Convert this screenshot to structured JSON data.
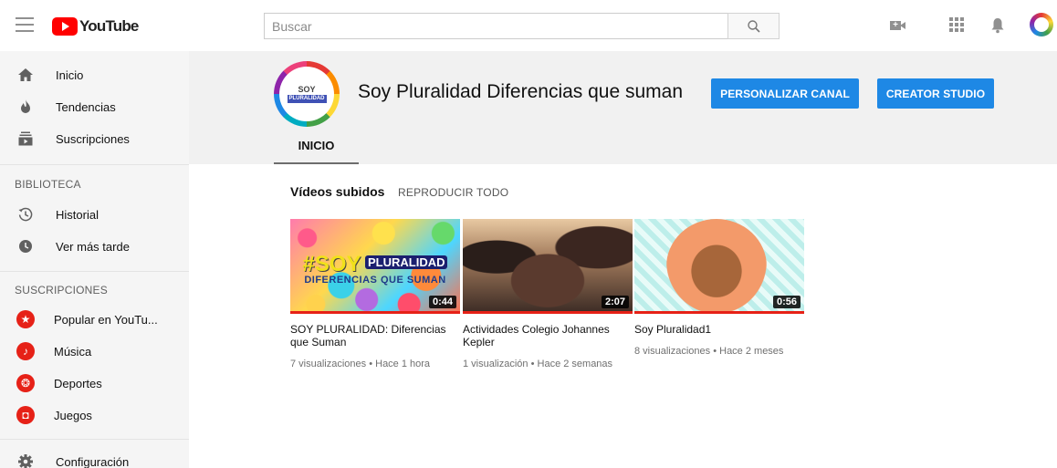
{
  "header": {
    "logo_text": "YouTube",
    "search_placeholder": "Buscar"
  },
  "sidebar": {
    "main": [
      {
        "label": "Inicio",
        "icon": "home-icon"
      },
      {
        "label": "Tendencias",
        "icon": "flame-icon"
      },
      {
        "label": "Suscripciones",
        "icon": "subscriptions-icon"
      }
    ],
    "library_heading": "BIBLIOTECA",
    "library": [
      {
        "label": "Historial",
        "icon": "history-icon"
      },
      {
        "label": "Ver más tarde",
        "icon": "clock-icon"
      }
    ],
    "subscriptions_heading": "SUSCRIPCIONES",
    "subscriptions": [
      {
        "label": "Popular en YouTu...",
        "icon": "star-icon"
      },
      {
        "label": "Música",
        "icon": "music-note-icon"
      },
      {
        "label": "Deportes",
        "icon": "ball-icon"
      },
      {
        "label": "Juegos",
        "icon": "gamepad-icon"
      }
    ],
    "settings_label": "Configuración"
  },
  "channel": {
    "avatar_text_top": "SOY",
    "avatar_text_bottom": "PLURALIDAD",
    "title": "Soy Pluralidad Diferencias que suman",
    "customize_button": "PERSONALIZAR CANAL",
    "studio_button": "CREATOR STUDIO",
    "tab_home": "INICIO"
  },
  "shelf": {
    "title": "Vídeos subidos",
    "play_all": "REPRODUCIR TODO",
    "videos": [
      {
        "title": "SOY PLURALIDAD: Diferencias que Suman",
        "meta": "7 visualizaciones • Hace 1 hora",
        "duration": "0:44",
        "thumb_text_a": "#SOY",
        "thumb_text_b": "PLURALIDAD",
        "thumb_text_c": "DIFERENCIAS QUE SUMAN"
      },
      {
        "title": "Actividades Colegio Johannes Kepler",
        "meta": "1 visualización • Hace 2 semanas",
        "duration": "2:07"
      },
      {
        "title": "Soy Pluralidad1",
        "meta": "8 visualizaciones • Hace 2 meses",
        "duration": "0:56"
      }
    ]
  },
  "colors": {
    "brand_red": "#ff0000",
    "button_blue": "#1e88e5",
    "sidebar_bg": "#f5f5f5",
    "header_bg": "#f1f1f1"
  }
}
